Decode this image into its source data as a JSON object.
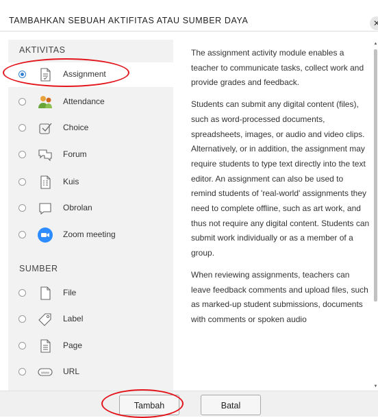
{
  "dialog": {
    "title": "TAMBAHKAN SEBUAH AKTIFITAS ATAU SUMBER DAYA",
    "close_icon": "close-icon"
  },
  "activities": {
    "heading": "AKTIVITAS",
    "items": [
      {
        "label": "Assignment",
        "icon": "assignment-icon",
        "selected": true
      },
      {
        "label": "Attendance",
        "icon": "attendance-icon",
        "selected": false
      },
      {
        "label": "Choice",
        "icon": "choice-icon",
        "selected": false
      },
      {
        "label": "Forum",
        "icon": "forum-icon",
        "selected": false
      },
      {
        "label": "Kuis",
        "icon": "quiz-icon",
        "selected": false
      },
      {
        "label": "Obrolan",
        "icon": "chat-icon",
        "selected": false
      },
      {
        "label": "Zoom meeting",
        "icon": "zoom-camera-icon",
        "selected": false
      }
    ]
  },
  "resources": {
    "heading": "SUMBER",
    "items": [
      {
        "label": "File",
        "icon": "file-icon",
        "selected": false
      },
      {
        "label": "Label",
        "icon": "label-tag-icon",
        "selected": false
      },
      {
        "label": "Page",
        "icon": "page-icon",
        "selected": false
      },
      {
        "label": "URL",
        "icon": "url-icon",
        "selected": false
      }
    ]
  },
  "description": {
    "paragraphs": [
      "The assignment activity module enables a teacher to communicate tasks, collect work and provide grades and feedback.",
      "Students can submit any digital content (files), such as word-processed documents, spreadsheets, images, or audio and video clips. Alternatively, or in addition, the assignment may require students to type text directly into the text editor. An assignment can also be used to remind students of 'real-world' assignments they need to complete offline, such as art work, and thus not require any digital content. Students can submit work individually or as a member of a group.",
      "When reviewing assignments, teachers can leave feedback comments and upload files, such as marked-up student submissions, documents with comments or spoken audio"
    ]
  },
  "footer": {
    "add_label": "Tambah",
    "cancel_label": "Batal"
  },
  "colors": {
    "accent": "#2f7fd3",
    "annotation": "#e3151c",
    "panel": "#f2f2f2"
  }
}
